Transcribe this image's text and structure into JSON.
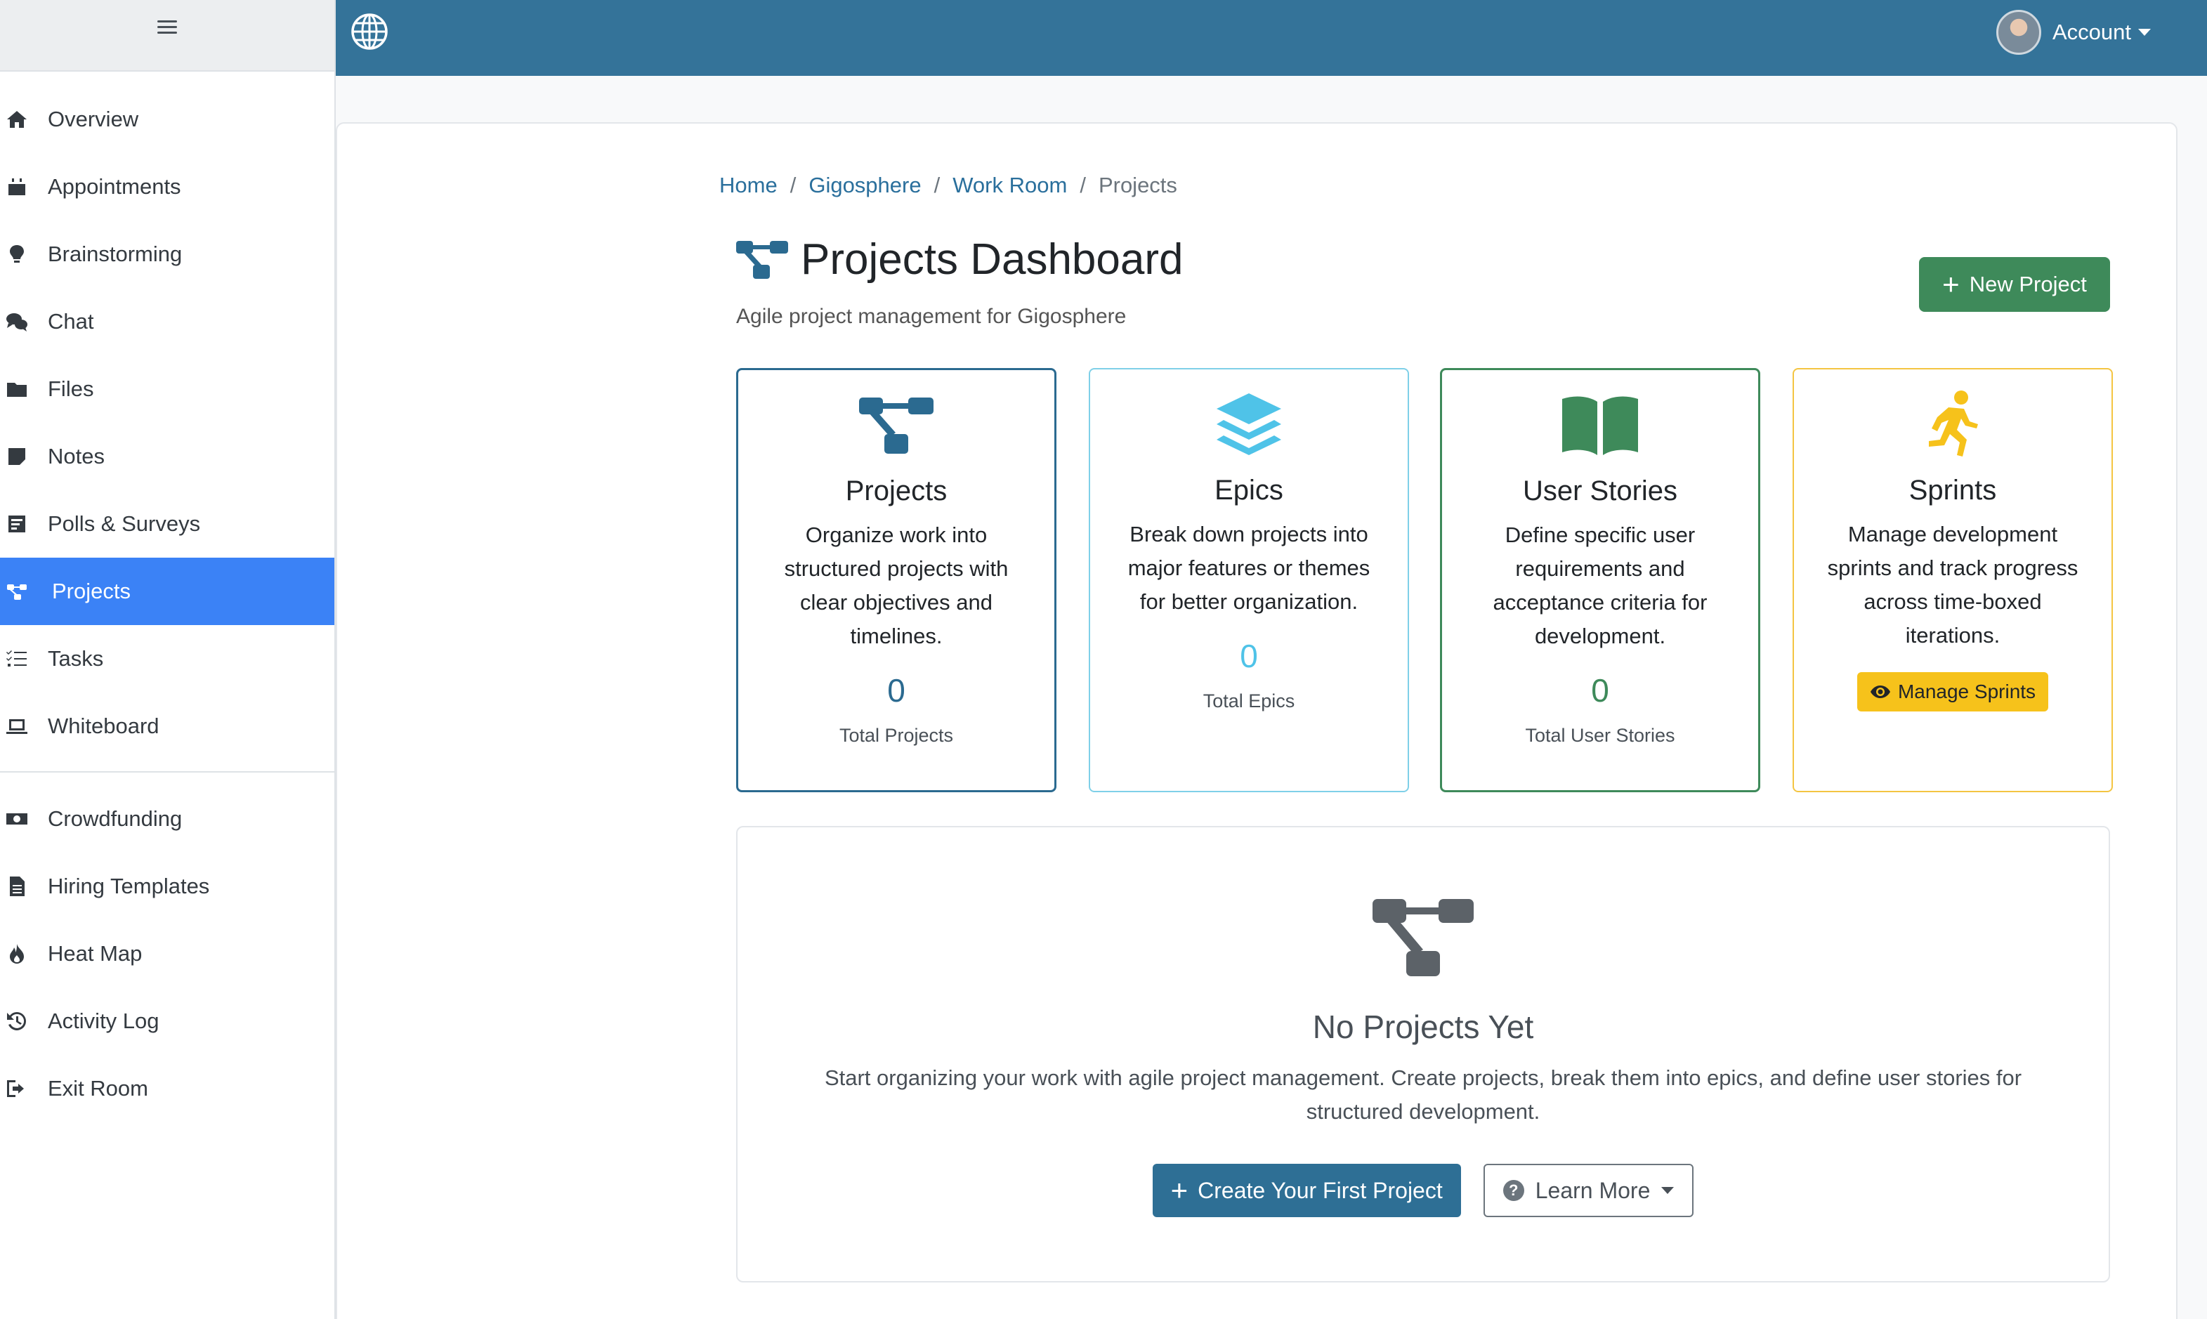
{
  "topbar": {
    "account_label": "Account"
  },
  "sidebar": {
    "items": [
      {
        "label": "Overview",
        "icon": "home-icon"
      },
      {
        "label": "Appointments",
        "icon": "calendar-icon"
      },
      {
        "label": "Brainstorming",
        "icon": "lightbulb-icon"
      },
      {
        "label": "Chat",
        "icon": "chat-icon"
      },
      {
        "label": "Files",
        "icon": "folder-icon"
      },
      {
        "label": "Notes",
        "icon": "note-icon"
      },
      {
        "label": "Polls & Surveys",
        "icon": "poll-icon"
      },
      {
        "label": "Projects",
        "icon": "project-diagram-icon",
        "active": true
      },
      {
        "label": "Tasks",
        "icon": "tasks-icon"
      },
      {
        "label": "Whiteboard",
        "icon": "laptop-icon"
      }
    ],
    "items2": [
      {
        "label": "Crowdfunding",
        "icon": "money-icon"
      },
      {
        "label": "Hiring Templates",
        "icon": "document-icon"
      },
      {
        "label": "Heat Map",
        "icon": "fire-icon"
      },
      {
        "label": "Activity Log",
        "icon": "history-icon"
      },
      {
        "label": "Exit Room",
        "icon": "exit-icon"
      }
    ]
  },
  "breadcrumb": {
    "home": "Home",
    "org": "Gigosphere",
    "room": "Work Room",
    "current": "Projects",
    "separator": "/"
  },
  "header": {
    "title": "Projects Dashboard",
    "subtitle": "Agile project management for Gigosphere",
    "new_project_label": "New Project"
  },
  "cards": [
    {
      "title": "Projects",
      "description": "Organize work into structured projects with clear objectives and timelines.",
      "count": "0",
      "count_label": "Total Projects",
      "color": "#2b6a90"
    },
    {
      "title": "Epics",
      "description": "Break down projects into major features or themes for better organization.",
      "count": "0",
      "count_label": "Total Epics",
      "color": "#4fc3e8"
    },
    {
      "title": "User Stories",
      "description": "Define specific user requirements and acceptance criteria for development.",
      "count": "0",
      "count_label": "Total User Stories",
      "color": "#3e8a5a"
    },
    {
      "title": "Sprints",
      "description": "Manage development sprints and track progress across time-boxed iterations.",
      "button_label": "Manage Sprints",
      "color": "#f6c21b"
    }
  ],
  "empty_state": {
    "title": "No Projects Yet",
    "description": "Start organizing your work with agile project management. Create projects, break them into epics, and define user stories for structured development.",
    "create_label": "Create Your First Project",
    "learn_label": "Learn More"
  }
}
